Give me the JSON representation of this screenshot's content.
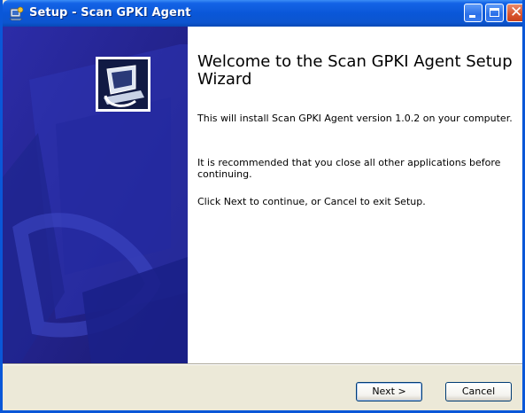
{
  "window": {
    "title": "Setup - Scan GPKI Agent",
    "icon": "setup-icon"
  },
  "titlebar_buttons": {
    "minimize": "minimize-icon",
    "maximize": "maximize-icon",
    "close": "close-icon"
  },
  "main": {
    "heading": "Welcome to the Scan GPKI Agent Setup Wizard",
    "paragraph1": "This will install Scan GPKI Agent version 1.0.2 on your computer.",
    "paragraph2": "It is recommended that you close all other applications before continuing.",
    "paragraph3": "Click Next to continue, or Cancel to exit Setup."
  },
  "buttons": {
    "next": "Next >",
    "cancel": "Cancel"
  },
  "colors": {
    "titlebar": "#0a57d8",
    "banner": "#2a2aa0",
    "face": "#ece9d8"
  }
}
